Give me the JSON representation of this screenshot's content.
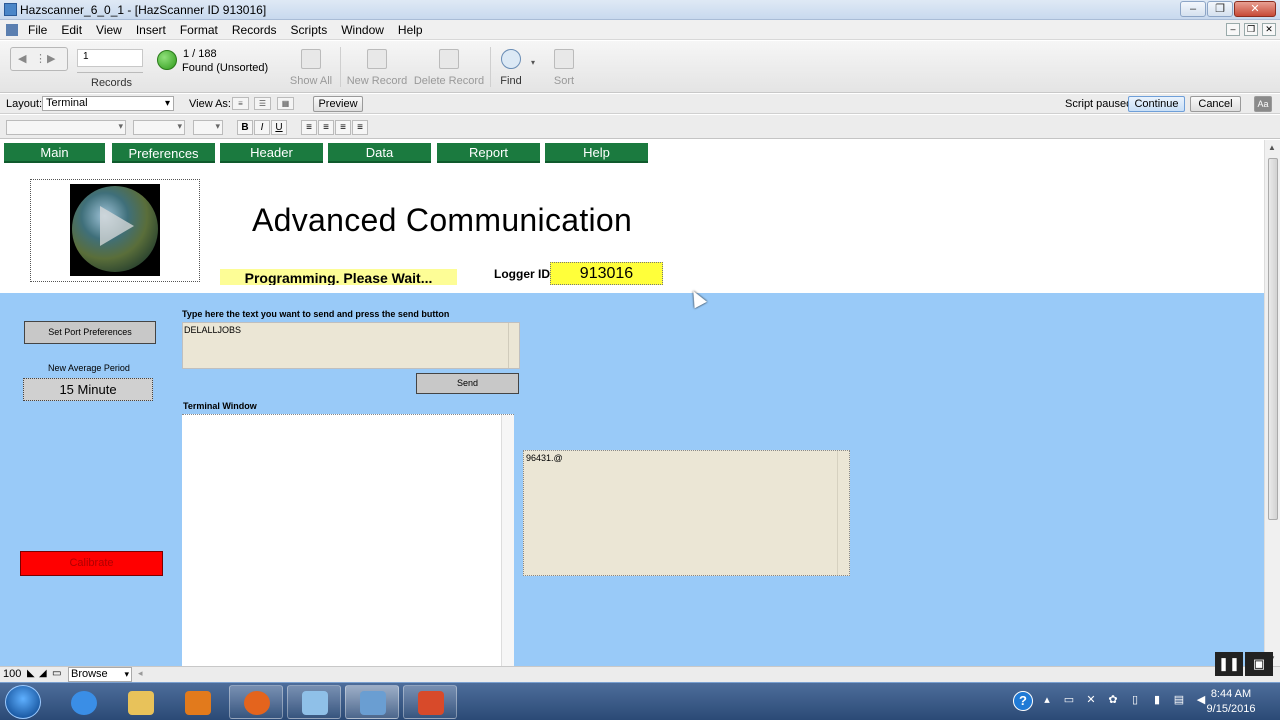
{
  "window": {
    "title": "Hazscanner_6_0_1 - [HazScanner ID 913016]"
  },
  "menu": [
    "File",
    "Edit",
    "View",
    "Insert",
    "Format",
    "Records",
    "Scripts",
    "Window",
    "Help"
  ],
  "status": {
    "record_input": "1",
    "records_label": "Records",
    "count": "1 / 188",
    "found": "Found (Unsorted)",
    "show_all": "Show All",
    "new_record": "New Record",
    "delete_record": "Delete Record",
    "find": "Find",
    "sort": "Sort"
  },
  "layoutbar": {
    "layout_label": "Layout:",
    "layout_value": "Terminal",
    "view_as_label": "View As:",
    "preview": "Preview",
    "script_paused": "Script paused",
    "continue": "Continue",
    "cancel": "Cancel",
    "aa": "Aa"
  },
  "tabs": [
    "Main",
    "Preferences",
    "Header",
    "Data",
    "Report",
    "Help"
  ],
  "header": {
    "title": "Advanced Communication",
    "wait": "Programming. Please Wait...",
    "logger_label": "Logger ID",
    "logger_id": "913016"
  },
  "panel": {
    "port_button": "Set Port Preferences",
    "avg_label": "New Average Period",
    "avg_value": "15 Minute",
    "calibrate": "Calibrate",
    "send_label": "Type here the text you want to send and press the send button",
    "send_text": "DELALLJOBS",
    "send_button": "Send",
    "terminal_label": "Terminal Window",
    "response_text": "96431.@"
  },
  "bottom": {
    "zoom": "100",
    "mode": "Browse"
  },
  "taskbar": {
    "time": "8:44 AM",
    "date": "9/15/2016"
  },
  "colors": {
    "tab_green": "#1b7a3f",
    "panel_blue": "#99caf8",
    "logger_yellow": "#ffff3a",
    "wait_yellow": "#fdfd96",
    "calibrate_red": "#ff0000",
    "field_beige": "#ebe6d5"
  }
}
